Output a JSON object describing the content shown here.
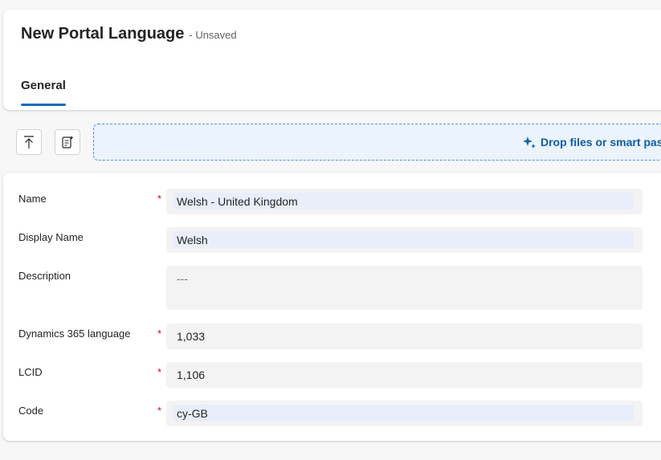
{
  "header": {
    "title": "New Portal Language",
    "status": "- Unsaved",
    "tabs": [
      {
        "label": "General"
      }
    ]
  },
  "toolbar": {
    "drop_label": "Drop files or smart paste"
  },
  "fields": [
    {
      "label": "Name",
      "required": true,
      "value": "Welsh - United Kingdom"
    },
    {
      "label": "Display Name",
      "required": false,
      "value": "Welsh"
    },
    {
      "label": "Description",
      "required": false,
      "value": "---"
    },
    {
      "label": "Dynamics 365 language",
      "required": true,
      "value": "1,033"
    },
    {
      "label": "LCID",
      "required": true,
      "value": "1,106"
    },
    {
      "label": "Code",
      "required": true,
      "value": "cy-GB"
    }
  ],
  "required_marker": "*"
}
